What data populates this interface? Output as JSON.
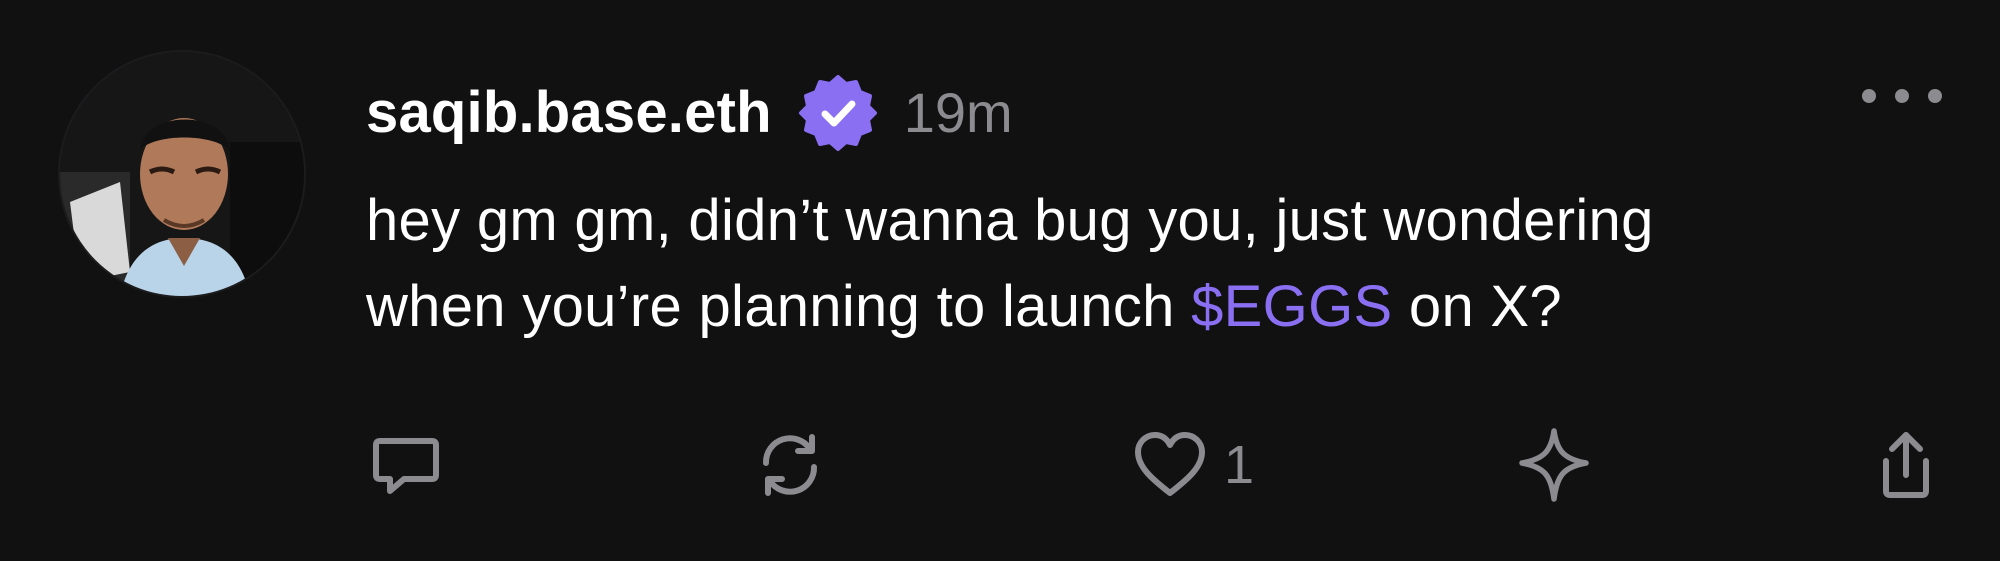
{
  "post": {
    "author": {
      "username": "saqib.base.eth",
      "verified": true,
      "avatar_icon": "profile-photo"
    },
    "timestamp": "19m",
    "body": {
      "line1": "hey gm gm, didn’t wanna bug you, just wondering",
      "line2_prefix": "when you’re planning to launch ",
      "cashtag": "$EGGS",
      "line2_suffix": " on X?"
    },
    "actions": {
      "reply_icon": "comment-icon",
      "recast_icon": "recast-icon",
      "like_icon": "heart-icon",
      "like_count": "1",
      "bookmark_icon": "sparkle-star-icon",
      "share_icon": "share-icon"
    },
    "colors": {
      "background": "#111112",
      "text": "#ffffff",
      "muted": "#8b8b90",
      "accent": "#8a6ff3"
    }
  }
}
